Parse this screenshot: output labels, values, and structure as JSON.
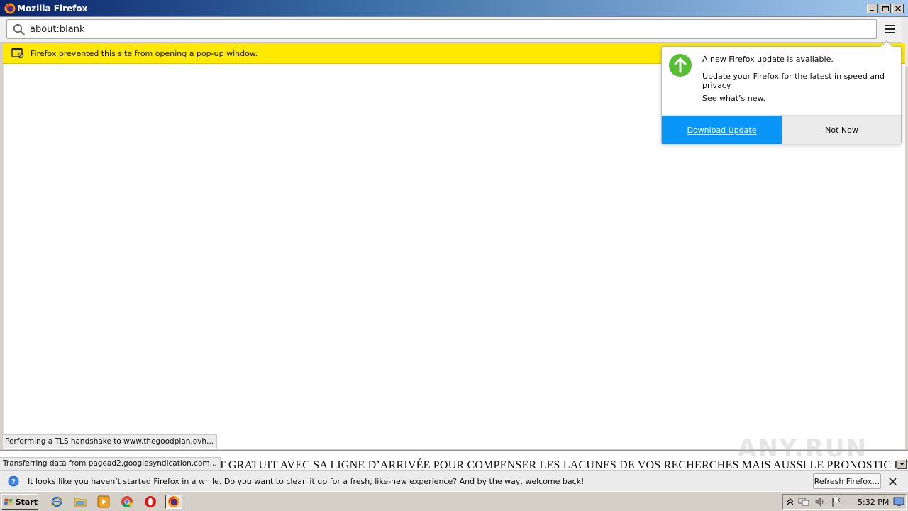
{
  "window": {
    "title": "Mozilla Firefox"
  },
  "urlbar": {
    "value": "about:blank"
  },
  "popup_notification": {
    "text": "Firefox prevented this site from opening a pop-up window."
  },
  "status": {
    "tls": "Performing a TLS handshake to www.thegoodplan.ovh...",
    "transfer": "Transferring data from pagead2.googlesyndication.com..."
  },
  "background_page": {
    "headline": "T GRATUIT AVEC SA LIGNE D’ARRIVÉE POUR COMPENSER LES LACUNES DE VOS RECHERCHES MAIS AUSSI LE PRONOSTIC DES"
  },
  "watermark": {
    "text": "ANY.RUN"
  },
  "update_doorhanger": {
    "title": "A new Firefox update is available.",
    "description": "Update your Firefox for the latest in speed and privacy.",
    "link": "See what’s new.",
    "primary_button": "Download Update",
    "secondary_button": "Not Now"
  },
  "refresh_notification": {
    "text": "It looks like you haven’t started Firefox in a while. Do you want to clean it up for a fresh, like-new experience? And by the way, welcome back!",
    "button": "Refresh Firefox…"
  },
  "taskbar": {
    "start_label": "Start",
    "clock": "5:32 PM"
  },
  "colors": {
    "popup_bar": "#ffe900",
    "primary_button": "#0996f8",
    "update_icon": "#57bd35"
  }
}
